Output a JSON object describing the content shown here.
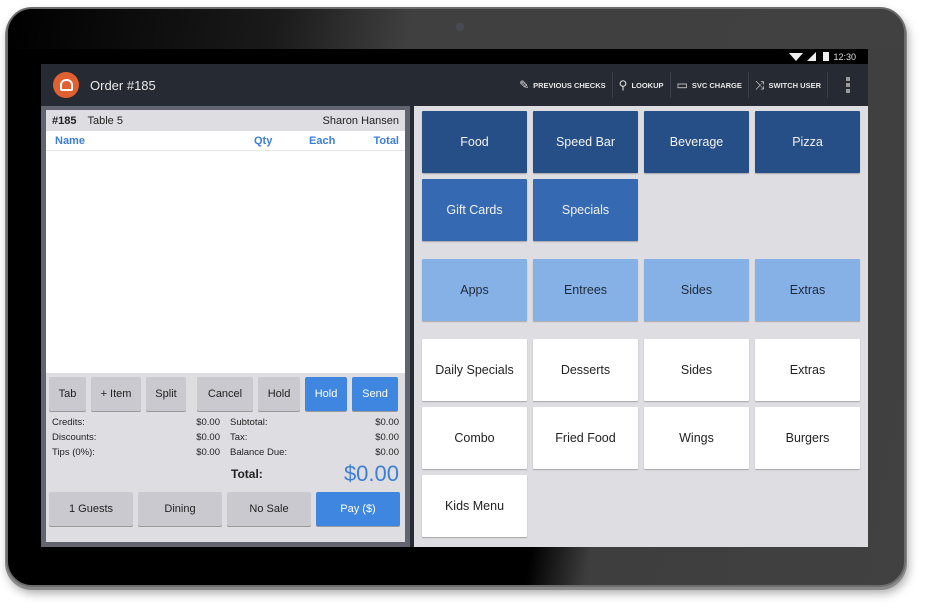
{
  "statusbar": {
    "time": "12:30",
    "icons": [
      "wifi-icon",
      "cell-signal-icon",
      "battery-icon"
    ]
  },
  "appbar": {
    "title": "Order #185",
    "actions": [
      {
        "label": "PREVIOUS CHECKS",
        "icon": "pencil-icon",
        "glyph": "✎"
      },
      {
        "label": "LOOKUP",
        "icon": "search-icon",
        "glyph": "⚲"
      },
      {
        "label": "SVC CHARGE",
        "icon": "card-icon",
        "glyph": "▭"
      },
      {
        "label": "SWITCH USER",
        "icon": "shuffle-icon",
        "glyph": "⤨"
      }
    ]
  },
  "ticket": {
    "number": "#185",
    "table": "Table 5",
    "server": "Sharon Hansen",
    "columns": {
      "name": "Name",
      "qty": "Qty",
      "each": "Each",
      "total": "Total"
    },
    "items": []
  },
  "actions_row": [
    {
      "label": "Tab",
      "style": "gray"
    },
    {
      "label": "+ Item",
      "style": "gray"
    },
    {
      "label": "Split",
      "style": "gray"
    },
    {
      "label": "Cancel",
      "style": "gray"
    },
    {
      "label": "Hold",
      "style": "gray"
    },
    {
      "label": "Hold",
      "style": "blue"
    },
    {
      "label": "Send",
      "style": "blue"
    }
  ],
  "totals": {
    "left": [
      {
        "label": "Credits:",
        "value": "$0.00"
      },
      {
        "label": "Discounts:",
        "value": "$0.00"
      },
      {
        "label": "Tips (0%):",
        "value": "$0.00"
      }
    ],
    "right": [
      {
        "label": "Subtotal:",
        "value": "$0.00"
      },
      {
        "label": "Tax:",
        "value": "$0.00"
      },
      {
        "label": "Balance Due:",
        "value": "$0.00"
      }
    ],
    "total_label": "Total:",
    "total_value": "$0.00"
  },
  "bottom_row": [
    {
      "label": "1 Guests",
      "style": "gray"
    },
    {
      "label": "Dining",
      "style": "gray"
    },
    {
      "label": "No Sale",
      "style": "gray"
    },
    {
      "label": "Pay ($)",
      "style": "blue"
    }
  ],
  "menu": {
    "colors": {
      "dark": "#274f87",
      "mid": "#3569b1",
      "light": "#85b1e6",
      "white": "#ffffff"
    },
    "departments": [
      {
        "label": "Food",
        "shade": "dark"
      },
      {
        "label": "Speed Bar",
        "shade": "dark"
      },
      {
        "label": "Beverage",
        "shade": "dark"
      },
      {
        "label": "Pizza",
        "shade": "dark"
      },
      {
        "label": "Gift Cards",
        "shade": "mid"
      },
      {
        "label": "Specials",
        "shade": "mid"
      }
    ],
    "groups": [
      {
        "label": "Apps",
        "shade": "light"
      },
      {
        "label": "Entrees",
        "shade": "light"
      },
      {
        "label": "Sides",
        "shade": "light"
      },
      {
        "label": "Extras",
        "shade": "light"
      }
    ],
    "categories": [
      {
        "label": "Daily Specials",
        "shade": "white"
      },
      {
        "label": "Desserts",
        "shade": "white"
      },
      {
        "label": "Sides",
        "shade": "white"
      },
      {
        "label": "Extras",
        "shade": "white"
      },
      {
        "label": "Combo",
        "shade": "white"
      },
      {
        "label": "Fried Food",
        "shade": "white"
      },
      {
        "label": "Wings",
        "shade": "white"
      },
      {
        "label": "Burgers",
        "shade": "white"
      },
      {
        "label": "Kids Menu",
        "shade": "white"
      }
    ]
  }
}
